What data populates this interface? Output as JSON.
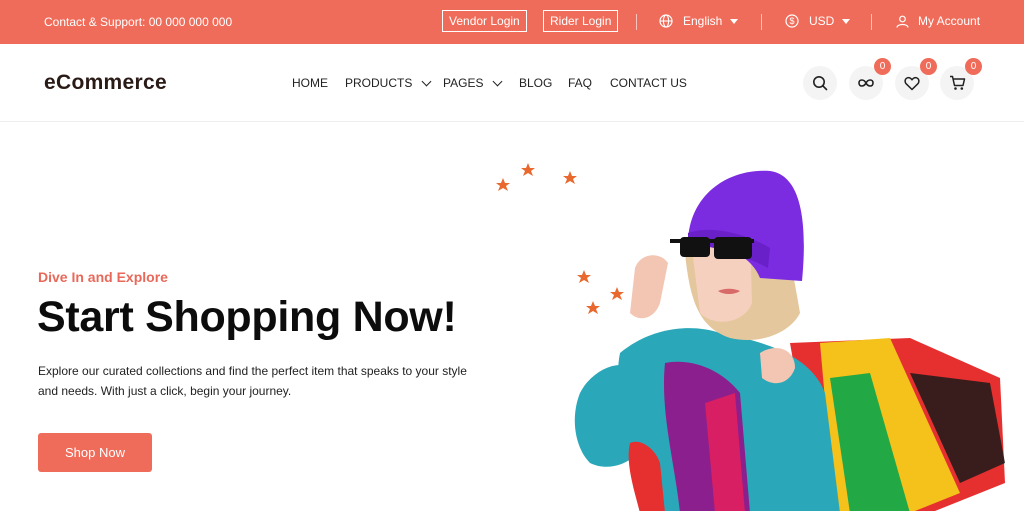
{
  "topbar": {
    "support": "Contact & Support: 00 000 000 000",
    "vendor_login": "Vendor Login",
    "rider_login": "Rider Login",
    "language": "English",
    "currency": "USD",
    "account": "My Account"
  },
  "header": {
    "logo": "eCommerce",
    "nav": {
      "home": "HOME",
      "products": "PRODUCTS",
      "pages": "PAGES",
      "blog": "BLOG",
      "faq": "FAQ",
      "contact": "CONTACT US"
    },
    "compare_count": "0",
    "wishlist_count": "0",
    "cart_count": "0"
  },
  "hero": {
    "eyebrow": "Dive In and Explore",
    "headline": "Start Shopping Now!",
    "description": "Explore our curated collections and find the perfect item that speaks to your style and needs. With just a click, begin your journey.",
    "cta": "Shop Now"
  },
  "colors": {
    "accent": "#f06c5a",
    "text": "#0c0c0c"
  }
}
